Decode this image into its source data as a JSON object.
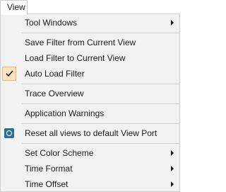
{
  "menubar": {
    "title": "View"
  },
  "menu": {
    "items": [
      {
        "label": "Tool Windows"
      },
      {
        "label": "Save Filter from Current View"
      },
      {
        "label": "Load Filter to Current View"
      },
      {
        "label": "Auto Load Filter",
        "checked": true
      },
      {
        "label": "Trace Overview"
      },
      {
        "label": "Application Warnings"
      },
      {
        "label": "Reset all views to default View Port",
        "icon": "viewport-icon"
      },
      {
        "label": "Set Color Scheme"
      },
      {
        "label": "Time Format"
      },
      {
        "label": "Time Offset"
      }
    ]
  },
  "colors": {
    "menu_background": "#f2f2f2",
    "check_highlight": "#fbe3c2",
    "icon_blue": "#2a6e93"
  }
}
